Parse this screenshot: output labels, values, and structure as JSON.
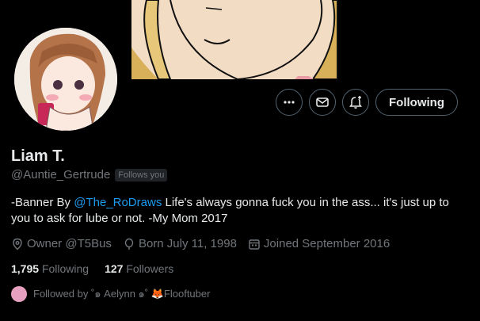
{
  "profile": {
    "display_name": "Liam T.",
    "handle": "@Auntie_Gertrude",
    "follows_you_badge": "Follows you",
    "bio_prefix": "-Banner By ",
    "bio_mention": "@The_RoDraws",
    "bio_text": " Life's always gonna fuck you in the ass... it's just up to you to ask for lube or not. -My Mom 2017",
    "location": "Owner @T5Bus",
    "birthday": "Born July 11, 1998",
    "joined": "Joined September 2016"
  },
  "stats": {
    "following_count": "1,795",
    "following_label": "Following",
    "followers_count": "127",
    "followers_label": "Followers"
  },
  "followed_by": {
    "text": "Followed by ˚๑ Aelynn ๑˚ 🦊Flooftuber"
  },
  "actions": {
    "following_label": "Following",
    "more_icon": "more-icon",
    "message_icon": "envelope-icon",
    "notify_icon": "bell-plus-icon"
  },
  "colors": {
    "accent": "#1d9bf0",
    "muted": "#71767b",
    "text": "#e7e9ea",
    "background": "#000000"
  }
}
